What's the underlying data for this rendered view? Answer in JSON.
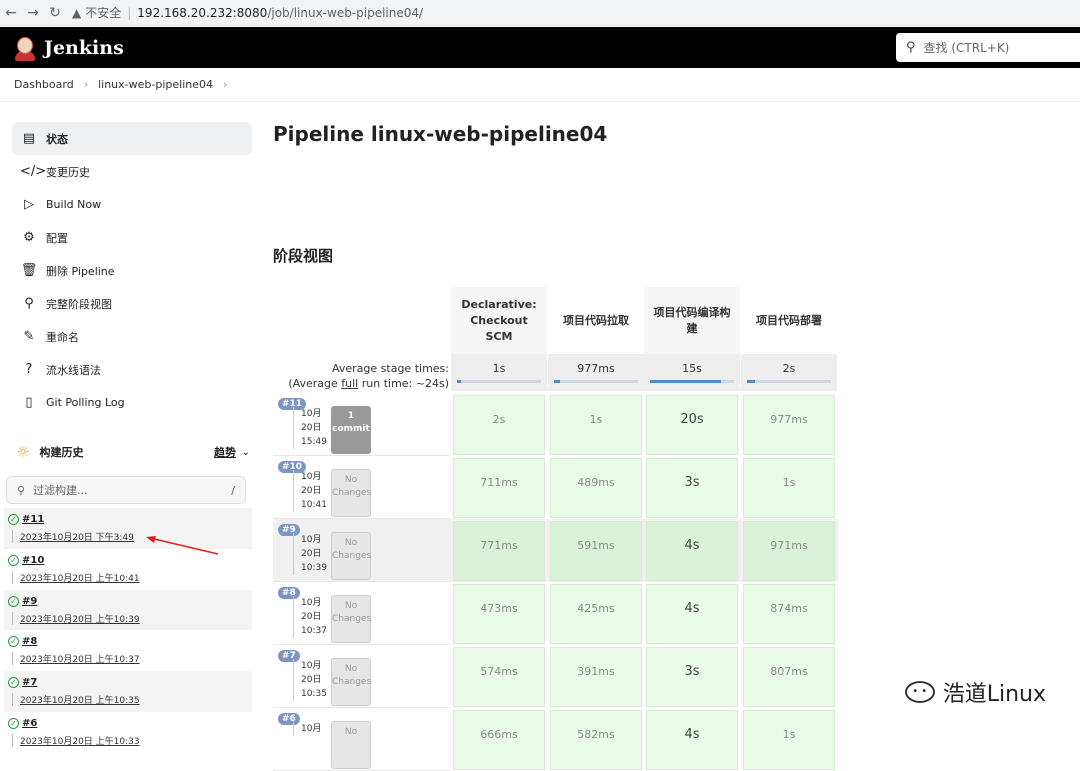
{
  "browser": {
    "insecure_label": "不安全",
    "host": "192.168.20.232:8080",
    "path": "/job/linux-web-pipeline04/"
  },
  "header": {
    "logo": "Jenkins",
    "search_placeholder": "查找 (CTRL+K)"
  },
  "breadcrumb": {
    "items": [
      "Dashboard",
      "linux-web-pipeline04"
    ]
  },
  "sidebar": {
    "tasks": [
      {
        "label": "状态",
        "icon": "document-icon"
      },
      {
        "label": "变更历史",
        "icon": "code-icon"
      },
      {
        "label": "Build Now",
        "icon": "play-icon"
      },
      {
        "label": "配置",
        "icon": "gear-icon"
      },
      {
        "label": "删除 Pipeline",
        "icon": "trash-icon"
      },
      {
        "label": "完整阶段视图",
        "icon": "search-icon"
      },
      {
        "label": "重命名",
        "icon": "pencil-icon"
      },
      {
        "label": "流水线语法",
        "icon": "help-icon"
      },
      {
        "label": "Git Polling Log",
        "icon": "clipboard-icon"
      }
    ],
    "build_history": {
      "title": "构建历史",
      "trend": "趋势",
      "filter_placeholder": "过滤构建...",
      "filter_shortcut": "/"
    },
    "builds": [
      {
        "num": "#11",
        "date": "2023年10月20日 下午3:49"
      },
      {
        "num": "#10",
        "date": "2023年10月20日 上午10:41"
      },
      {
        "num": "#9",
        "date": "2023年10月20日 上午10:39"
      },
      {
        "num": "#8",
        "date": "2023年10月20日 上午10:37"
      },
      {
        "num": "#7",
        "date": "2023年10月20日 上午10:35"
      },
      {
        "num": "#6",
        "date": "2023年10月20日 上午10:33"
      }
    ]
  },
  "main": {
    "title": "Pipeline linux-web-pipeline04",
    "stage_view_title": "阶段视图",
    "avg_label_1": "Average stage times:",
    "avg_label_2a": "(Average ",
    "avg_label_2b": "full",
    "avg_label_2c": " run time: ~24s)",
    "stages": [
      {
        "name": "Declarative: Checkout SCM",
        "avg": "1s",
        "avg_fraction": 0.05
      },
      {
        "name": "项目代码拉取",
        "avg": "977ms",
        "avg_fraction": 0.07
      },
      {
        "name": "项目代码编译构建",
        "avg": "15s",
        "avg_fraction": 0.85
      },
      {
        "name": "项目代码部署",
        "avg": "2s",
        "avg_fraction": 0.1
      }
    ],
    "runs": [
      {
        "badge": "#11",
        "month": "10月",
        "day": "20日",
        "time": "15:49",
        "changes": "1 commit",
        "times": [
          "2s",
          "1s",
          "20s",
          "977ms"
        ]
      },
      {
        "badge": "#10",
        "month": "10月",
        "day": "20日",
        "time": "10:41",
        "changes": "No Changes",
        "times": [
          "711ms",
          "489ms",
          "3s",
          "1s"
        ]
      },
      {
        "badge": "#9",
        "month": "10月",
        "day": "20日",
        "time": "10:39",
        "changes": "No Changes",
        "times": [
          "771ms",
          "591ms",
          "4s",
          "971ms"
        ]
      },
      {
        "badge": "#8",
        "month": "10月",
        "day": "20日",
        "time": "10:37",
        "changes": "No Changes",
        "times": [
          "473ms",
          "425ms",
          "4s",
          "874ms"
        ]
      },
      {
        "badge": "#7",
        "month": "10月",
        "day": "20日",
        "time": "10:35",
        "changes": "No Changes",
        "times": [
          "574ms",
          "391ms",
          "3s",
          "807ms"
        ]
      },
      {
        "badge": "#6",
        "month": "10月",
        "day": "",
        "time": "",
        "changes": "No",
        "times": [
          "666ms",
          "582ms",
          "4s",
          "1s"
        ]
      }
    ]
  },
  "watermark": "浩道Linux"
}
